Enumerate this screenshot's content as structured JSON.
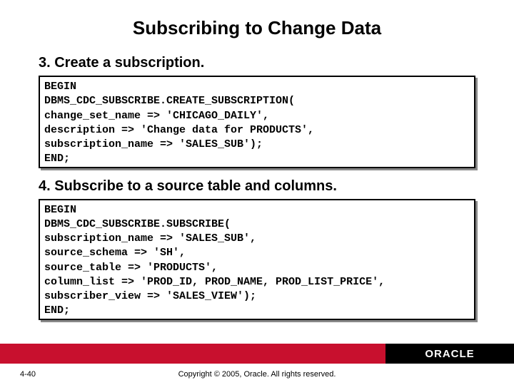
{
  "title": "Subscribing to Change Data",
  "step3": {
    "heading": "3.   Create a subscription.",
    "code": "BEGIN\nDBMS_CDC_SUBSCRIBE.CREATE_SUBSCRIPTION(\nchange_set_name => 'CHICAGO_DAILY',\ndescription => 'Change data for PRODUCTS',\nsubscription_name => 'SALES_SUB');\nEND;"
  },
  "step4": {
    "heading": "4.   Subscribe to a source table and columns.",
    "code": "BEGIN\nDBMS_CDC_SUBSCRIBE.SUBSCRIBE(\nsubscription_name => 'SALES_SUB',\nsource_schema => 'SH',\nsource_table => 'PRODUCTS',\ncolumn_list => 'PROD_ID, PROD_NAME, PROD_LIST_PRICE',\nsubscriber_view => 'SALES_VIEW');\nEND;"
  },
  "logo": "ORACLE",
  "slide_number": "4-40",
  "copyright": "Copyright © 2005, Oracle.  All rights reserved."
}
